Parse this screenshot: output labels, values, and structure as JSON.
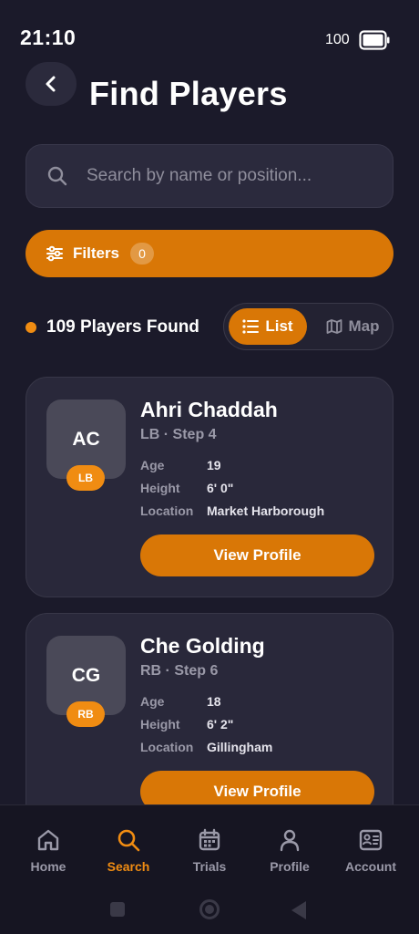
{
  "status_bar": {
    "time": "21:10",
    "battery": "100"
  },
  "header": {
    "title": "Find Players"
  },
  "search": {
    "placeholder": "Search by name or position..."
  },
  "filters": {
    "label": "Filters",
    "count": "0"
  },
  "results": {
    "label": "109 Players Found"
  },
  "view_toggle": {
    "list_label": "List",
    "map_label": "Map",
    "selected": "List"
  },
  "players": [
    {
      "initials": "AC",
      "position_badge": "LB",
      "name": "Ahri Chaddah",
      "subtitle": "LB · Step 4",
      "details": [
        {
          "key": "Age",
          "value": "19"
        },
        {
          "key": "Height",
          "value": "6' 0\""
        },
        {
          "key": "Location",
          "value": "Market Harborough"
        }
      ],
      "button_label": "View Profile"
    },
    {
      "initials": "CG",
      "position_badge": "RB",
      "name": "Che Golding",
      "subtitle": "RB · Step 6",
      "details": [
        {
          "key": "Age",
          "value": "18"
        },
        {
          "key": "Height",
          "value": "6' 2\""
        },
        {
          "key": "Location",
          "value": "Gillingham"
        }
      ],
      "button_label": "View Profile"
    }
  ],
  "bottom_nav": {
    "items": [
      {
        "label": "Home",
        "icon": "home-icon"
      },
      {
        "label": "Search",
        "icon": "search-icon"
      },
      {
        "label": "Trials",
        "icon": "calendar-icon"
      },
      {
        "label": "Profile",
        "icon": "person-icon"
      },
      {
        "label": "Account",
        "icon": "id-card-icon"
      }
    ],
    "active": "Search"
  },
  "colors": {
    "accent": "#d97706",
    "background": "#1b1a2a",
    "card": "#29283a"
  }
}
